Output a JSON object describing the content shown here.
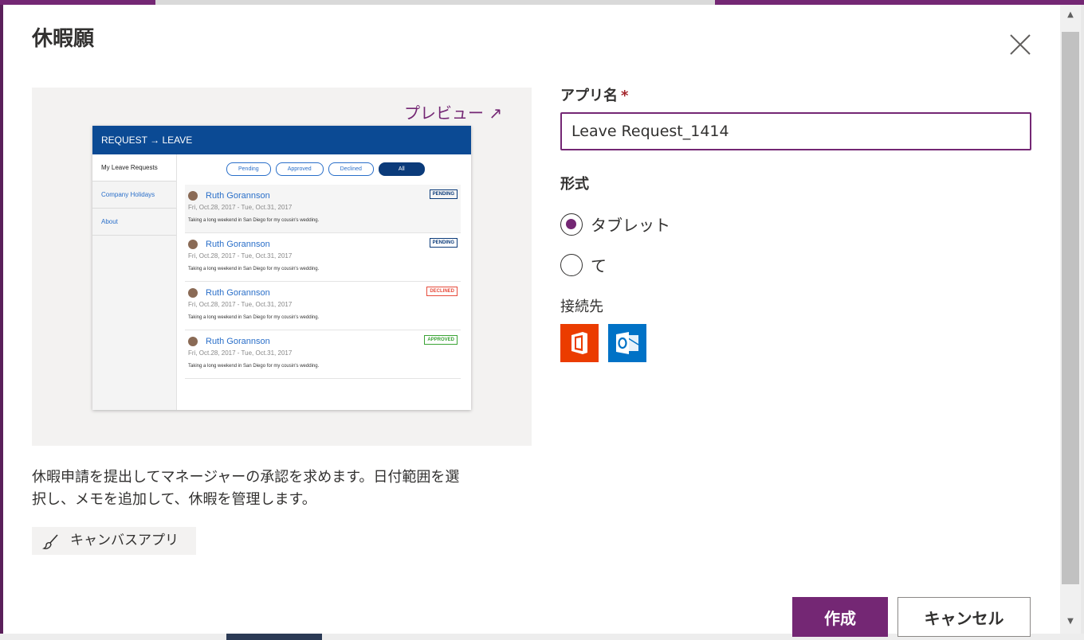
{
  "dialog": {
    "title": "休暇願",
    "close_icon": "close-icon"
  },
  "preview": {
    "link_label": "プレビュー ↗",
    "mock_app": {
      "header": "REQUEST → LEAVE",
      "sidebar": [
        "My Leave Requests",
        "Company Holidays",
        "About"
      ],
      "filters": [
        "Pending",
        "Approved",
        "Declined",
        "All"
      ],
      "cards": [
        {
          "name": "Ruth Gorannson",
          "dates": "Fri, Oct.28, 2017 - Tue, Oct.31, 2017",
          "note": "Taking a long weekend in San Diego for my cousin's wedding.",
          "status": "PENDING"
        },
        {
          "name": "Ruth Gorannson",
          "dates": "Fri, Oct.28, 2017 - Tue, Oct.31, 2017",
          "note": "Taking a long weekend in San Diego for my cousin's wedding.",
          "status": "PENDING"
        },
        {
          "name": "Ruth Gorannson",
          "dates": "Fri, Oct.28, 2017 - Tue, Oct.31, 2017",
          "note": "Taking a long weekend in San Diego for my cousin's wedding.",
          "status": "DECLINED"
        },
        {
          "name": "Ruth Gorannson",
          "dates": "Fri, Oct.28, 2017 - Tue, Oct.31, 2017",
          "note": "Taking a long weekend in San Diego for my cousin's wedding.",
          "status": "APPROVED"
        }
      ]
    }
  },
  "description": "休暇申請を提出してマネージャーの承認を求めます。日付範囲を選択し、メモを追加して、休暇を管理します。",
  "tag": {
    "label": "キャンバスアプリ",
    "icon": "paintbrush-icon"
  },
  "form": {
    "app_name_label": "アプリ名",
    "required_mark": "*",
    "app_name_value": "Leave Request_1414",
    "format_label": "形式",
    "format_options": [
      {
        "label": "タブレット",
        "checked": true
      },
      {
        "label": "て",
        "checked": false
      }
    ],
    "connections_label": "接続先",
    "connections": [
      {
        "icon": "office365-icon",
        "color": "#eb3c00"
      },
      {
        "icon": "outlook-icon",
        "color": "#0072c6"
      }
    ]
  },
  "buttons": {
    "create": "作成",
    "cancel": "キャンセル"
  },
  "colors": {
    "accent": "#742774",
    "preview_bg": "#f3f2f1",
    "mock_header": "#0b4a94"
  }
}
